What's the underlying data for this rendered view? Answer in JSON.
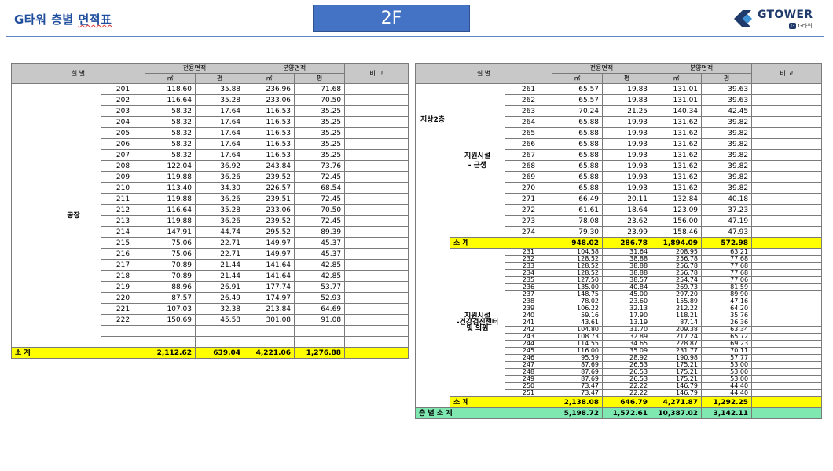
{
  "header": {
    "title_prefix": "G타워 층별 ",
    "title_word": "면적표",
    "floor": "2F",
    "logo_name": "GTOWER",
    "logo_badge": "G",
    "logo_sub": "G타워"
  },
  "columns": {
    "room": "실    별",
    "exclusive": "전용면적",
    "sale": "분양면적",
    "note": "비  고",
    "m2": "㎡",
    "py": "평"
  },
  "left_table": {
    "group": "공장",
    "rows": [
      [
        "201",
        "118.60",
        "35.88",
        "236.96",
        "71.68"
      ],
      [
        "202",
        "116.64",
        "35.28",
        "233.06",
        "70.50"
      ],
      [
        "203",
        "58.32",
        "17.64",
        "116.53",
        "35.25"
      ],
      [
        "204",
        "58.32",
        "17.64",
        "116.53",
        "35.25"
      ],
      [
        "205",
        "58.32",
        "17.64",
        "116.53",
        "35.25"
      ],
      [
        "206",
        "58.32",
        "17.64",
        "116.53",
        "35.25"
      ],
      [
        "207",
        "58.32",
        "17.64",
        "116.53",
        "35.25"
      ],
      [
        "208",
        "122.04",
        "36.92",
        "243.84",
        "73.76"
      ],
      [
        "209",
        "119.88",
        "36.26",
        "239.52",
        "72.45"
      ],
      [
        "210",
        "113.40",
        "34.30",
        "226.57",
        "68.54"
      ],
      [
        "211",
        "119.88",
        "36.26",
        "239.51",
        "72.45"
      ],
      [
        "212",
        "116.64",
        "35.28",
        "233.06",
        "70.50"
      ],
      [
        "213",
        "119.88",
        "36.26",
        "239.52",
        "72.45"
      ],
      [
        "214",
        "147.91",
        "44.74",
        "295.52",
        "89.39"
      ],
      [
        "215",
        "75.06",
        "22.71",
        "149.97",
        "45.37"
      ],
      [
        "216",
        "75.06",
        "22.71",
        "149.97",
        "45.37"
      ],
      [
        "217",
        "70.89",
        "21.44",
        "141.64",
        "42.85"
      ],
      [
        "218",
        "70.89",
        "21.44",
        "141.64",
        "42.85"
      ],
      [
        "219",
        "88.96",
        "26.91",
        "177.74",
        "53.77"
      ],
      [
        "220",
        "87.57",
        "26.49",
        "174.97",
        "52.93"
      ],
      [
        "221",
        "107.03",
        "32.38",
        "213.84",
        "64.69"
      ],
      [
        "222",
        "150.69",
        "45.58",
        "301.08",
        "91.08"
      ]
    ],
    "subtotal_label": "소  계",
    "subtotal": [
      "2,112.62",
      "639.04",
      "4,221.06",
      "1,276.88"
    ]
  },
  "right_table": {
    "floor_label": "지상2층",
    "group1": "지원시설\n- 근생",
    "rows1": [
      [
        "261",
        "65.57",
        "19.83",
        "131.01",
        "39.63"
      ],
      [
        "262",
        "65.57",
        "19.83",
        "131.01",
        "39.63"
      ],
      [
        "263",
        "70.24",
        "21.25",
        "140.34",
        "42.45"
      ],
      [
        "264",
        "65.88",
        "19.93",
        "131.62",
        "39.82"
      ],
      [
        "265",
        "65.88",
        "19.93",
        "131.62",
        "39.82"
      ],
      [
        "266",
        "65.88",
        "19.93",
        "131.62",
        "39.82"
      ],
      [
        "267",
        "65.88",
        "19.93",
        "131.62",
        "39.82"
      ],
      [
        "268",
        "65.88",
        "19.93",
        "131.62",
        "39.82"
      ],
      [
        "269",
        "65.88",
        "19.93",
        "131.62",
        "39.82"
      ],
      [
        "270",
        "65.88",
        "19.93",
        "131.62",
        "39.82"
      ],
      [
        "271",
        "66.49",
        "20.11",
        "132.84",
        "40.18"
      ],
      [
        "272",
        "61.61",
        "18.64",
        "123.09",
        "37.23"
      ],
      [
        "273",
        "78.08",
        "23.62",
        "156.00",
        "47.19"
      ],
      [
        "274",
        "79.30",
        "23.99",
        "158.46",
        "47.93"
      ]
    ],
    "subtotal1_label": "소  계",
    "subtotal1": [
      "948.02",
      "286.78",
      "1,894.09",
      "572.98"
    ],
    "group2": "지원시설\n-건강검진센터\n및 의원",
    "rows2": [
      [
        "231",
        "104.58",
        "31.64",
        "208.95",
        "63.21"
      ],
      [
        "232",
        "128.52",
        "38.88",
        "256.78",
        "77.68"
      ],
      [
        "233",
        "128.52",
        "38.88",
        "256.78",
        "77.68"
      ],
      [
        "234",
        "128.52",
        "38.88",
        "256.78",
        "77.68"
      ],
      [
        "235",
        "127.50",
        "38.57",
        "254.74",
        "77.06"
      ],
      [
        "236",
        "135.00",
        "40.84",
        "269.73",
        "81.59"
      ],
      [
        "237",
        "148.75",
        "45.00",
        "297.20",
        "89.90"
      ],
      [
        "238",
        "78.02",
        "23.60",
        "155.89",
        "47.16"
      ],
      [
        "239",
        "106.22",
        "32.13",
        "212.22",
        "64.20"
      ],
      [
        "240",
        "59.16",
        "17.90",
        "118.21",
        "35.76"
      ],
      [
        "241",
        "43.61",
        "13.19",
        "87.14",
        "26.36"
      ],
      [
        "242",
        "104.80",
        "31.70",
        "209.38",
        "63.34"
      ],
      [
        "243",
        "108.73",
        "32.89",
        "217.24",
        "65.72"
      ],
      [
        "244",
        "114.55",
        "34.65",
        "228.87",
        "69.23"
      ],
      [
        "245",
        "116.00",
        "35.09",
        "231.77",
        "70.11"
      ],
      [
        "246",
        "95.59",
        "28.92",
        "190.98",
        "57.77"
      ],
      [
        "247",
        "87.69",
        "26.53",
        "175.21",
        "53.00"
      ],
      [
        "248",
        "87.69",
        "26.53",
        "175.21",
        "53.00"
      ],
      [
        "249",
        "87.69",
        "26.53",
        "175.21",
        "53.00"
      ],
      [
        "250",
        "73.47",
        "22.22",
        "146.79",
        "44.40"
      ],
      [
        "251",
        "73.47",
        "22.22",
        "146.79",
        "44.40"
      ]
    ],
    "subtotal2_label": "소  계",
    "subtotal2": [
      "2,138.08",
      "646.79",
      "4,271.87",
      "1,292.25"
    ],
    "floor_total_label": "층 별 소 계",
    "floor_total": [
      "5,198.72",
      "1,572.61",
      "10,387.02",
      "3,142.11"
    ]
  },
  "colors": {
    "subtotal_bg": "#ffff00",
    "floor_total_bg": "#7fe8b0",
    "header_bg": "#c8c8c8",
    "badge_bg": "#4472c4",
    "title_color": "#1f4e9c"
  }
}
